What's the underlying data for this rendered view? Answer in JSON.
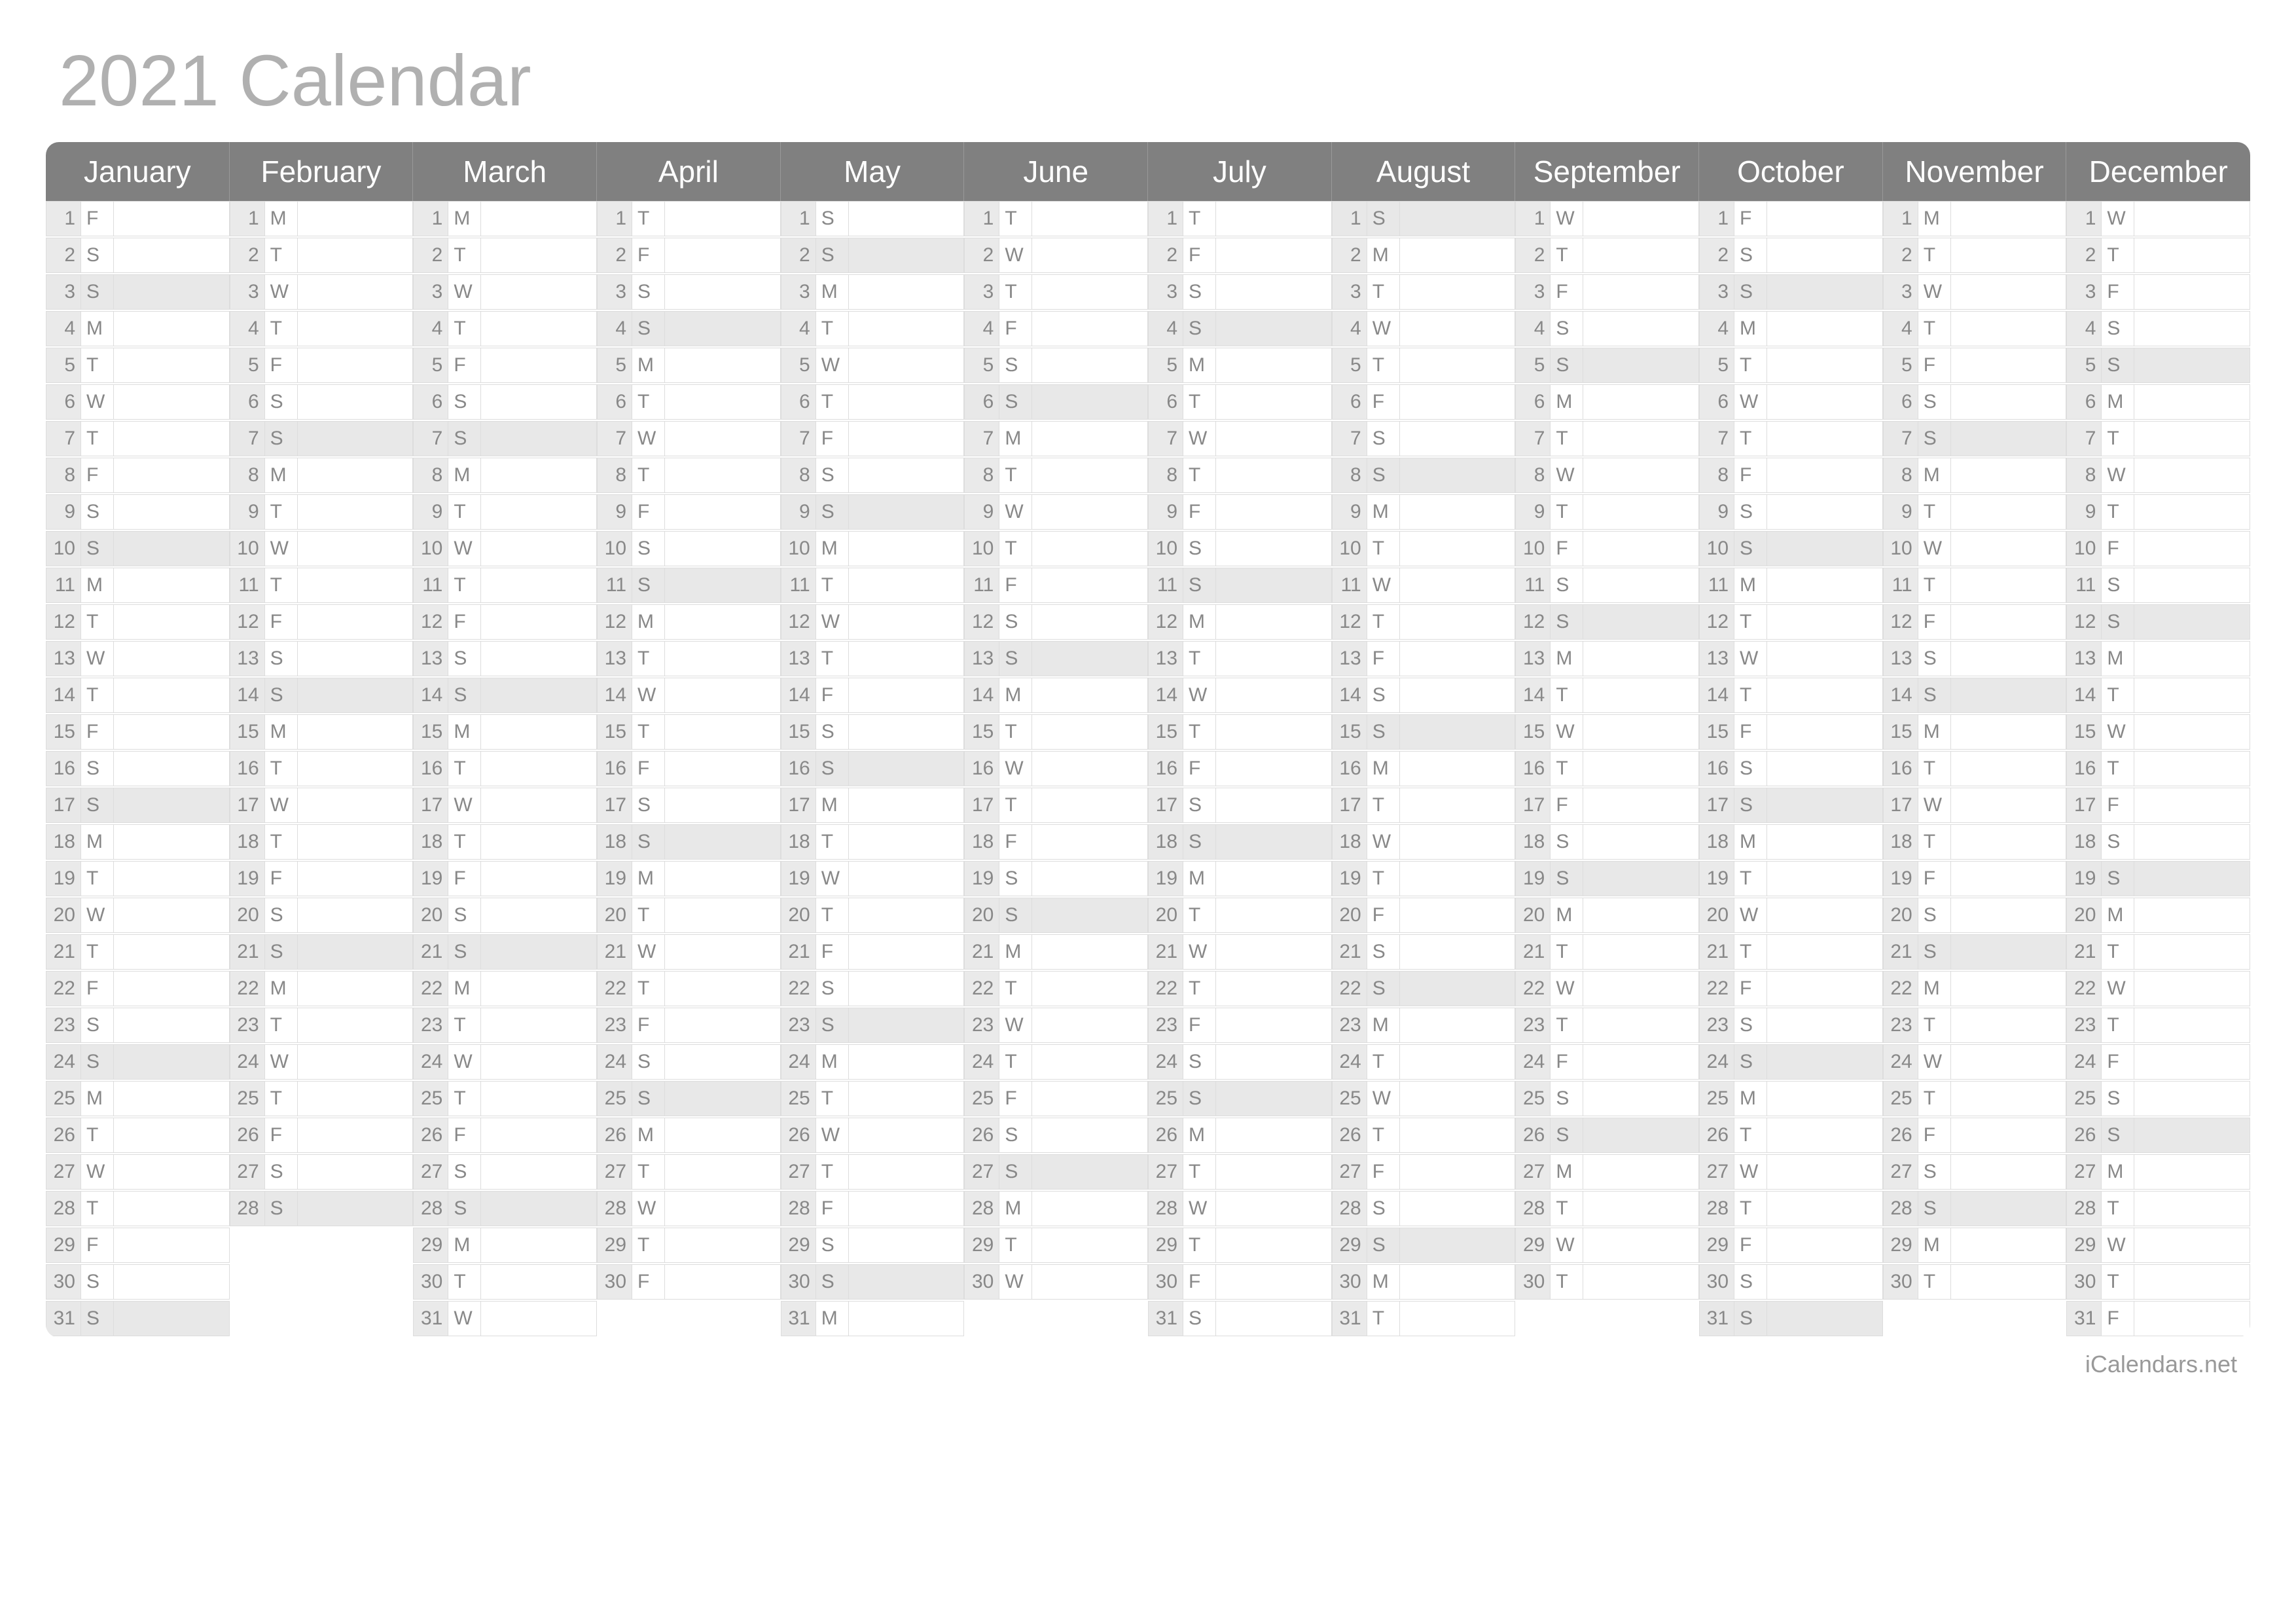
{
  "title": "2021 Calendar",
  "footer": "iCalendars.net",
  "weekdays": [
    "S",
    "M",
    "T",
    "W",
    "T",
    "F",
    "S"
  ],
  "max_days": 31,
  "months": [
    {
      "name": "January",
      "days": 31,
      "start": 5
    },
    {
      "name": "February",
      "days": 28,
      "start": 1
    },
    {
      "name": "March",
      "days": 31,
      "start": 1
    },
    {
      "name": "April",
      "days": 30,
      "start": 4
    },
    {
      "name": "May",
      "days": 31,
      "start": 6
    },
    {
      "name": "June",
      "days": 30,
      "start": 2
    },
    {
      "name": "July",
      "days": 31,
      "start": 4
    },
    {
      "name": "August",
      "days": 31,
      "start": 0
    },
    {
      "name": "September",
      "days": 30,
      "start": 3
    },
    {
      "name": "October",
      "days": 31,
      "start": 5
    },
    {
      "name": "November",
      "days": 30,
      "start": 1
    },
    {
      "name": "December",
      "days": 31,
      "start": 3
    }
  ]
}
